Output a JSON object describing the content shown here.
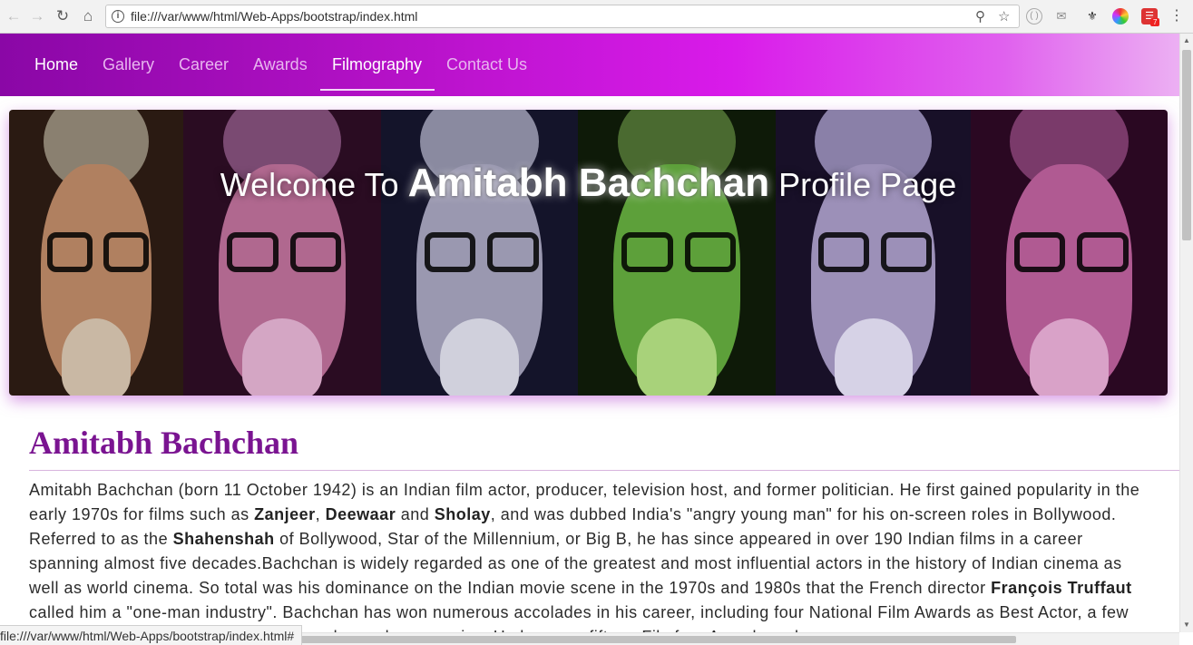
{
  "browser": {
    "url": "file:///var/www/html/Web-Apps/bootstrap/index.html",
    "status_url": "file:///var/www/html/Web-Apps/bootstrap/index.html#",
    "icons": [
      "back-icon",
      "forward-icon",
      "reload-icon",
      "home-icon",
      "info-icon",
      "zoom-icon",
      "bookmark-star-icon"
    ],
    "extension_badge": "7"
  },
  "navbar": {
    "items": [
      {
        "label": "Home",
        "active": true
      },
      {
        "label": "Gallery"
      },
      {
        "label": "Career"
      },
      {
        "label": "Awards"
      },
      {
        "label": "Filmography",
        "active": true
      },
      {
        "label": "Contact Us"
      }
    ]
  },
  "banner": {
    "title_prefix": "Welcome To",
    "title_name": "Amitabh Bachchan",
    "title_suffix": "Profile Page"
  },
  "content": {
    "heading": "Amitabh Bachchan",
    "bio": [
      {
        "t": "Amitabh Bachchan (born 11 October 1942) is an Indian film actor, producer, television host, and former politician. He first gained popularity in the early 1970s for films such as "
      },
      {
        "t": "Zanjeer",
        "b": true
      },
      {
        "t": ", "
      },
      {
        "t": "Deewaar",
        "b": true
      },
      {
        "t": " and "
      },
      {
        "t": "Sholay",
        "b": true
      },
      {
        "t": ", and was dubbed India's \"angry young man\" for his on-screen roles in Bollywood. Referred to as the "
      },
      {
        "t": "Shahenshah",
        "b": true
      },
      {
        "t": " of Bollywood, Star of the Millennium, or Big B, he has since appeared in over 190 Indian films in a career spanning almost five decades.Bachchan is widely regarded as one of the greatest and most influential actors in the history of Indian cinema as well as world cinema. So total was his dominance on the Indian movie scene in the 1970s and 1980s that the French director "
      },
      {
        "t": "François Truffaut",
        "b": true
      },
      {
        "t": " called him a \"one-man industry\". Bachchan has won numerous accolades in his career, including four National Film Awards as Best Actor, a few awards at international film festivals and award ceremonies. He has won fifteen Filmfare Awards and"
      }
    ]
  },
  "colors": {
    "navbar_start": "#8a07a6",
    "navbar_end": "#ecb0f3",
    "heading": "#7a1491",
    "nav_inactive": "#e8b6ef"
  }
}
